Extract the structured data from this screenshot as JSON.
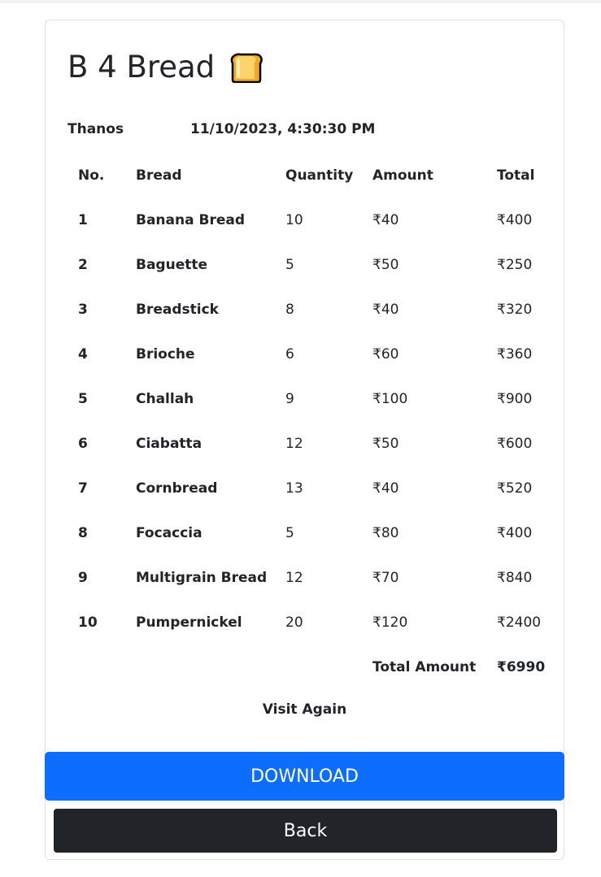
{
  "header": {
    "title": "B 4 Bread",
    "icon": "bread-icon"
  },
  "customer": {
    "name": "Thanos",
    "datetime": "11/10/2023, 4:30:30 PM"
  },
  "table": {
    "headers": [
      "No.",
      "Bread",
      "Quantity",
      "Amount",
      "Total"
    ],
    "rows": [
      {
        "no": "1",
        "bread": "Banana Bread",
        "qty": "10",
        "amount": "₹40",
        "total": "₹400"
      },
      {
        "no": "2",
        "bread": "Baguette",
        "qty": "5",
        "amount": "₹50",
        "total": "₹250"
      },
      {
        "no": "3",
        "bread": "Breadstick",
        "qty": "8",
        "amount": "₹40",
        "total": "₹320"
      },
      {
        "no": "4",
        "bread": "Brioche",
        "qty": "6",
        "amount": "₹60",
        "total": "₹360"
      },
      {
        "no": "5",
        "bread": "Challah",
        "qty": "9",
        "amount": "₹100",
        "total": "₹900"
      },
      {
        "no": "6",
        "bread": "Ciabatta",
        "qty": "12",
        "amount": "₹50",
        "total": "₹600"
      },
      {
        "no": "7",
        "bread": "Cornbread",
        "qty": "13",
        "amount": "₹40",
        "total": "₹520"
      },
      {
        "no": "8",
        "bread": "Focaccia",
        "qty": "5",
        "amount": "₹80",
        "total": "₹400"
      },
      {
        "no": "9",
        "bread": "Multigrain Bread",
        "qty": "12",
        "amount": "₹70",
        "total": "₹840"
      },
      {
        "no": "10",
        "bread": "Pumpernickel",
        "qty": "20",
        "amount": "₹120",
        "total": "₹2400"
      }
    ],
    "total_label": "Total Amount",
    "total_value": "₹6990"
  },
  "footer": {
    "visit_text": "Visit Again",
    "download_label": "DOWNLOAD",
    "back_label": "Back"
  },
  "colors": {
    "primary": "#0d6efd",
    "dark": "#212529"
  }
}
